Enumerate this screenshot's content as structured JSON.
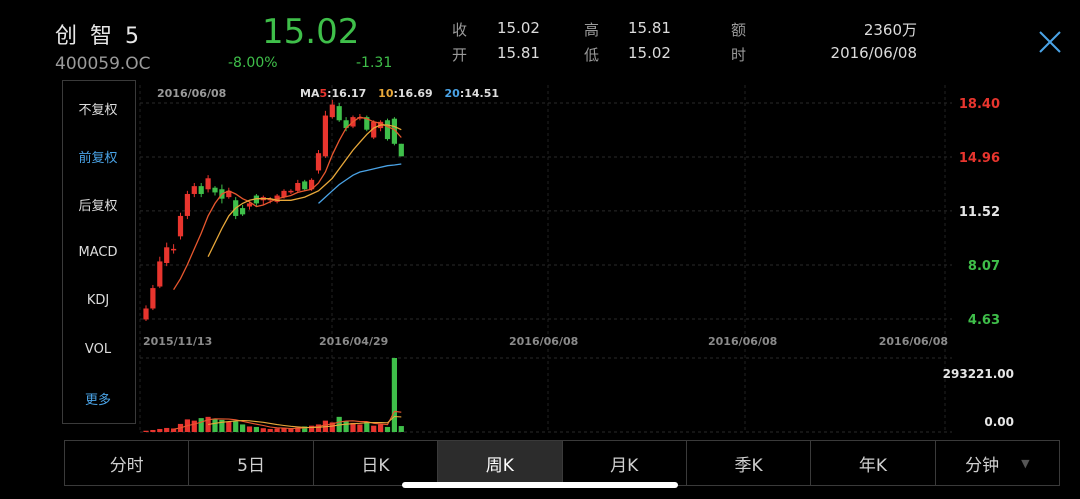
{
  "stock": {
    "name": "创 智 5",
    "code": "400059.OC",
    "price": "15.02",
    "change_pct": "-8.00%",
    "change": "-1.31",
    "colors": {
      "up": "#e8352e",
      "down": "#3fbf4a",
      "accent": "#4aa3e6"
    }
  },
  "quote": {
    "close_label": "收",
    "close_value": "15.02",
    "high_label": "高",
    "high_value": "15.81",
    "amount_label": "额",
    "amount_value": "2360万",
    "open_label": "开",
    "open_value": "15.81",
    "low_label": "低",
    "low_value": "15.02",
    "time_label": "时",
    "time_value": "2016/06/08"
  },
  "close_icon": "close-icon",
  "sidebar": {
    "items": [
      {
        "label": "不复权"
      },
      {
        "label": "前复权",
        "active": true
      },
      {
        "label": "后复权"
      },
      {
        "label": "MACD"
      },
      {
        "label": "KDJ"
      },
      {
        "label": "VOL"
      },
      {
        "label": "更多"
      }
    ]
  },
  "chart_data": {
    "type": "candlestick",
    "date_label": "2016/06/08",
    "ma": {
      "ma5_prefix": "MA",
      "ma5_period": "5",
      "ma5_value": ":16.17",
      "ma10_period": "10",
      "ma10_value": ":16.69",
      "ma20_period": "20",
      "ma20_value": ":14.51"
    },
    "y_ticks": [
      "18.40",
      "14.96",
      "11.52",
      "8.07",
      "4.63"
    ],
    "y_values": [
      18.4,
      14.96,
      11.52,
      8.07,
      4.63
    ],
    "ylim": [
      4.63,
      18.4
    ],
    "x_ticks": [
      "2015/11/13",
      "2016/04/29",
      "2016/06/08",
      "2016/06/08",
      "2016/06/08"
    ],
    "volume_ticks": [
      "293221.00",
      "0.00"
    ],
    "volume_max": 293221,
    "candles": [
      {
        "o": 4.6,
        "c": 5.3,
        "h": 5.5,
        "l": 4.5,
        "v": 5000
      },
      {
        "o": 5.3,
        "c": 6.6,
        "h": 6.8,
        "l": 5.2,
        "v": 8000
      },
      {
        "o": 6.7,
        "c": 8.3,
        "h": 8.6,
        "l": 6.6,
        "v": 12000
      },
      {
        "o": 8.2,
        "c": 9.2,
        "h": 9.5,
        "l": 8.0,
        "v": 16000
      },
      {
        "o": 9.1,
        "c": 9.1,
        "h": 9.4,
        "l": 8.8,
        "v": 14000
      },
      {
        "o": 9.9,
        "c": 11.2,
        "h": 11.4,
        "l": 9.7,
        "v": 32000
      },
      {
        "o": 11.2,
        "c": 12.6,
        "h": 12.8,
        "l": 11.0,
        "v": 50000
      },
      {
        "o": 12.6,
        "c": 13.1,
        "h": 13.3,
        "l": 12.4,
        "v": 45000
      },
      {
        "o": 13.1,
        "c": 12.6,
        "h": 13.3,
        "l": 12.4,
        "v": 55000
      },
      {
        "o": 12.9,
        "c": 13.6,
        "h": 13.8,
        "l": 12.7,
        "v": 60000
      },
      {
        "o": 13.0,
        "c": 12.7,
        "h": 13.1,
        "l": 12.5,
        "v": 52000
      },
      {
        "o": 12.9,
        "c": 12.3,
        "h": 13.2,
        "l": 12.0,
        "v": 48000
      },
      {
        "o": 12.4,
        "c": 12.8,
        "h": 13.0,
        "l": 12.3,
        "v": 40000
      },
      {
        "o": 12.2,
        "c": 11.2,
        "h": 12.4,
        "l": 11.0,
        "v": 42000
      },
      {
        "o": 11.7,
        "c": 11.3,
        "h": 11.9,
        "l": 11.2,
        "v": 30000
      },
      {
        "o": 11.8,
        "c": 12.0,
        "h": 12.1,
        "l": 11.6,
        "v": 22000
      },
      {
        "o": 12.5,
        "c": 12.0,
        "h": 12.6,
        "l": 11.8,
        "v": 20000
      },
      {
        "o": 12.2,
        "c": 12.4,
        "h": 12.5,
        "l": 11.9,
        "v": 15000
      },
      {
        "o": 12.2,
        "c": 12.3,
        "h": 12.4,
        "l": 12.0,
        "v": 12000
      },
      {
        "o": 12.1,
        "c": 12.5,
        "h": 12.6,
        "l": 12.0,
        "v": 14000
      },
      {
        "o": 12.4,
        "c": 12.8,
        "h": 12.9,
        "l": 12.3,
        "v": 16000
      },
      {
        "o": 12.8,
        "c": 12.8,
        "h": 12.9,
        "l": 12.6,
        "v": 13000
      },
      {
        "o": 12.8,
        "c": 13.3,
        "h": 13.5,
        "l": 12.7,
        "v": 18000
      },
      {
        "o": 13.4,
        "c": 12.9,
        "h": 13.5,
        "l": 12.8,
        "v": 22000
      },
      {
        "o": 12.9,
        "c": 13.5,
        "h": 13.6,
        "l": 12.8,
        "v": 25000
      },
      {
        "o": 14.1,
        "c": 15.2,
        "h": 15.4,
        "l": 13.9,
        "v": 30000
      },
      {
        "o": 15.0,
        "c": 17.6,
        "h": 17.9,
        "l": 14.9,
        "v": 45000
      },
      {
        "o": 17.5,
        "c": 18.3,
        "h": 18.6,
        "l": 17.4,
        "v": 38000
      },
      {
        "o": 18.2,
        "c": 17.3,
        "h": 18.4,
        "l": 17.2,
        "v": 60000
      },
      {
        "o": 17.3,
        "c": 16.8,
        "h": 17.5,
        "l": 16.6,
        "v": 42000
      },
      {
        "o": 16.9,
        "c": 17.5,
        "h": 17.6,
        "l": 16.8,
        "v": 36000
      },
      {
        "o": 17.5,
        "c": 17.5,
        "h": 17.7,
        "l": 17.3,
        "v": 30000
      },
      {
        "o": 17.5,
        "c": 16.7,
        "h": 17.6,
        "l": 16.6,
        "v": 40000
      },
      {
        "o": 16.2,
        "c": 17.2,
        "h": 17.3,
        "l": 16.1,
        "v": 25000
      },
      {
        "o": 16.8,
        "c": 17.2,
        "h": 17.3,
        "l": 16.6,
        "v": 30000
      },
      {
        "o": 17.3,
        "c": 16.1,
        "h": 17.4,
        "l": 16.0,
        "v": 20000
      },
      {
        "o": 17.4,
        "c": 15.8,
        "h": 17.5,
        "l": 15.7,
        "v": 293221
      },
      {
        "o": 15.8,
        "c": 15.0,
        "h": 15.8,
        "l": 15.0,
        "v": 23600
      }
    ],
    "ma5": [
      null,
      null,
      null,
      null,
      6.5,
      7.2,
      8.1,
      9.1,
      10.1,
      11.2,
      12.0,
      12.6,
      12.8,
      12.6,
      12.3,
      12.1,
      11.8,
      11.9,
      12.1,
      12.3,
      12.4,
      12.5,
      12.7,
      12.8,
      12.9,
      13.3,
      14.0,
      15.1,
      16.0,
      16.8,
      17.2,
      17.5,
      17.4,
      17.2,
      17.1,
      16.9,
      16.7,
      16.2
    ],
    "ma10": [
      null,
      null,
      null,
      null,
      null,
      null,
      null,
      null,
      null,
      8.6,
      9.5,
      10.4,
      11.2,
      11.7,
      12.0,
      12.2,
      12.3,
      12.3,
      12.3,
      12.2,
      12.2,
      12.2,
      12.3,
      12.4,
      12.6,
      12.8,
      13.2,
      13.6,
      14.2,
      14.8,
      15.4,
      15.9,
      16.4,
      16.8,
      17.0,
      17.0,
      16.9,
      16.7
    ],
    "ma20": [
      null,
      null,
      null,
      null,
      null,
      null,
      null,
      null,
      null,
      null,
      null,
      null,
      null,
      null,
      null,
      null,
      null,
      null,
      null,
      null,
      null,
      null,
      null,
      null,
      null,
      12.0,
      12.4,
      12.8,
      13.2,
      13.5,
      13.8,
      14.0,
      14.1,
      14.2,
      14.3,
      14.4,
      14.45,
      14.51
    ]
  },
  "tabs": [
    {
      "label": "分时"
    },
    {
      "label": "5日"
    },
    {
      "label": "日K"
    },
    {
      "label": "周K",
      "active": true
    },
    {
      "label": "月K"
    },
    {
      "label": "季K"
    },
    {
      "label": "年K"
    },
    {
      "label": "分钟",
      "dropdown": true
    }
  ],
  "dropdown_caret": "▼"
}
